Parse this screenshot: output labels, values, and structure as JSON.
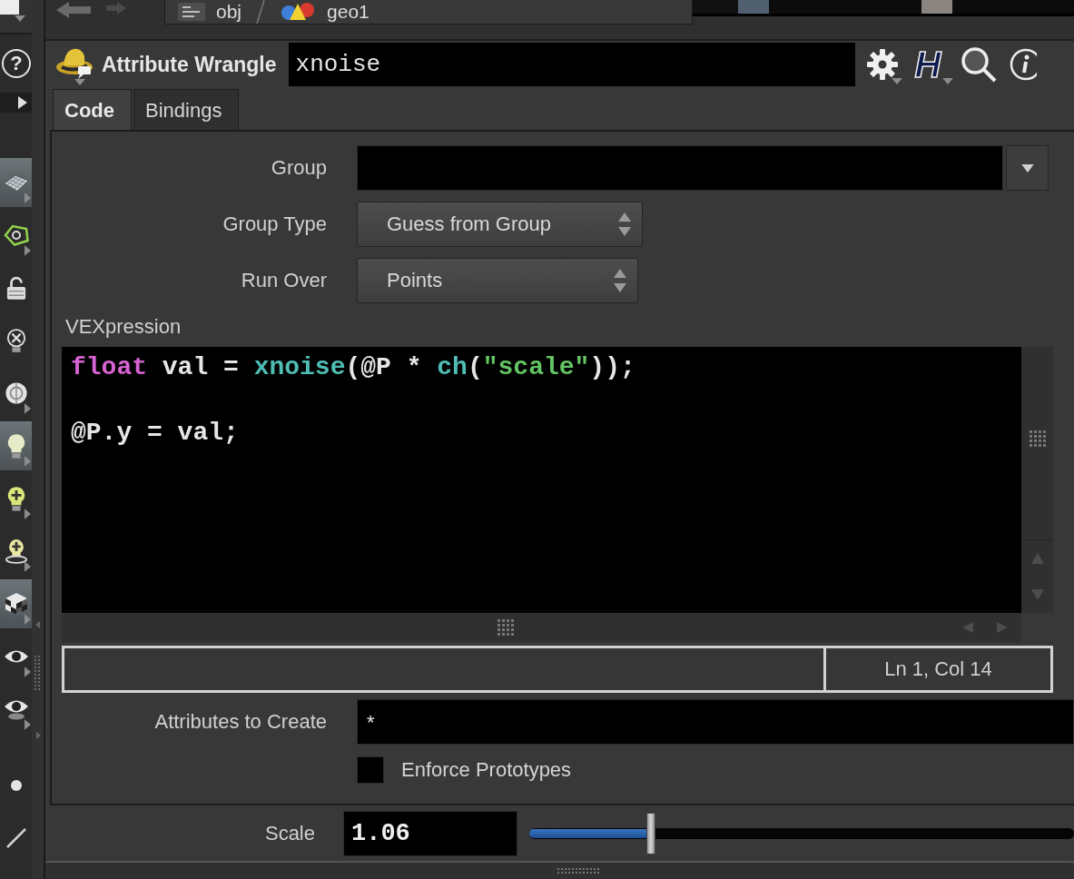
{
  "shelf": {
    "help_button": "?",
    "tools": [
      {
        "kind": "grid",
        "active": true,
        "menu": true
      },
      {
        "kind": "polygon",
        "active": false,
        "menu": true
      },
      {
        "kind": "lock",
        "active": false,
        "menu": false
      },
      {
        "kind": "bulb_cross",
        "active": false,
        "menu": false
      },
      {
        "kind": "disc",
        "active": false,
        "menu": true
      },
      {
        "kind": "bulb",
        "active": true,
        "menu": true
      },
      {
        "kind": "bulb_plus",
        "active": false,
        "menu": true
      },
      {
        "kind": "bulb_plus_ring",
        "active": false,
        "menu": true
      },
      {
        "kind": "checker",
        "active": true,
        "menu": true
      },
      {
        "kind": "eye",
        "active": false,
        "menu": true
      },
      {
        "kind": "eye_lens",
        "active": false,
        "menu": true
      },
      {
        "kind": "dot",
        "active": false,
        "menu": false
      },
      {
        "kind": "pen",
        "active": false,
        "menu": false
      }
    ]
  },
  "path_bar": {
    "crumbs": [
      {
        "kind": "network",
        "label": "obj"
      },
      {
        "kind": "geometry",
        "label": "geo1"
      }
    ]
  },
  "node": {
    "type": "Attribute Wrangle",
    "name": "xnoise",
    "h_button": "H"
  },
  "tabs": [
    {
      "label": "Code",
      "selected": true
    },
    {
      "label": "Bindings",
      "selected": false
    }
  ],
  "parameters": [
    {
      "kind": "string_menu",
      "label": "Group"
    },
    {
      "kind": "menu",
      "label": "Group Type",
      "value": "Guess from Group"
    },
    {
      "kind": "menu",
      "label": "Run Over",
      "value": "Points"
    }
  ],
  "vexpression": {
    "label": "VEXpression",
    "lines": [
      {
        "kind": "code",
        "tokens": [
          {
            "kind": "keyword",
            "text": "float"
          },
          {
            "kind": "plain",
            "text": " val = "
          },
          {
            "kind": "function",
            "text": "xnoise"
          },
          {
            "kind": "plain",
            "text": "(@P * "
          },
          {
            "kind": "function",
            "text": "ch"
          },
          {
            "kind": "plain",
            "text": "("
          },
          {
            "kind": "string",
            "text": "\"scale\""
          },
          {
            "kind": "plain",
            "text": "));"
          }
        ]
      },
      {
        "kind": "blank"
      },
      {
        "kind": "code",
        "tokens": [
          {
            "kind": "plain",
            "text": "@P.y = val;"
          }
        ]
      }
    ],
    "status": "Ln 1, Col 14"
  },
  "attributes_to_create": {
    "label": "Attributes to Create",
    "value": "*"
  },
  "enforce_prototypes": {
    "label": "Enforce Prototypes",
    "checked": false
  },
  "scale": {
    "label": "Scale",
    "value": "1.06",
    "level": 0.22
  }
}
